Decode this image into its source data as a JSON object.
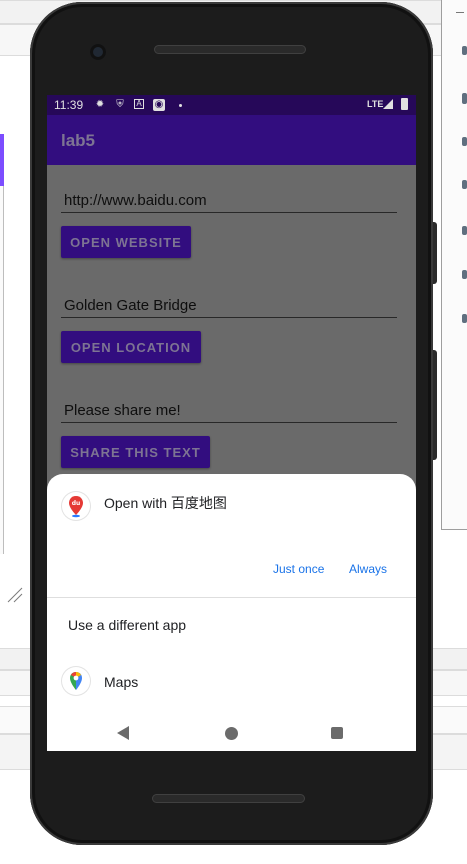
{
  "status_bar": {
    "time": "11:39",
    "network": "LTE",
    "icons": [
      "settings-icon",
      "shield-icon",
      "a-icon",
      "assistant-icon",
      "dot-icon",
      "signal-icon",
      "battery-icon"
    ]
  },
  "app_bar": {
    "title": "lab5"
  },
  "main": {
    "url_field": {
      "value": "http://www.baidu.com"
    },
    "open_website_button": "OPEN WEBSITE",
    "location_field": {
      "value": "Golden Gate Bridge"
    },
    "open_location_button": "OPEN LOCATION",
    "share_field": {
      "value": "Please share me!"
    },
    "share_button": "SHARE THIS TEXT"
  },
  "chooser_sheet": {
    "title": "Open with 百度地图",
    "just_once": "Just once",
    "always": "Always",
    "different_app": "Use a different app",
    "apps": [
      {
        "label": "Maps",
        "icon": "google-maps-icon"
      }
    ],
    "primary_app_icon": "baidu-maps-icon"
  },
  "nav": {
    "icons": [
      "back-icon",
      "home-icon",
      "recents-icon"
    ]
  },
  "colors": {
    "status_bar": "#2c0a66",
    "primary": "#3a0f91",
    "accent_link": "#1a73e8",
    "content_dimmed": "#797979"
  }
}
